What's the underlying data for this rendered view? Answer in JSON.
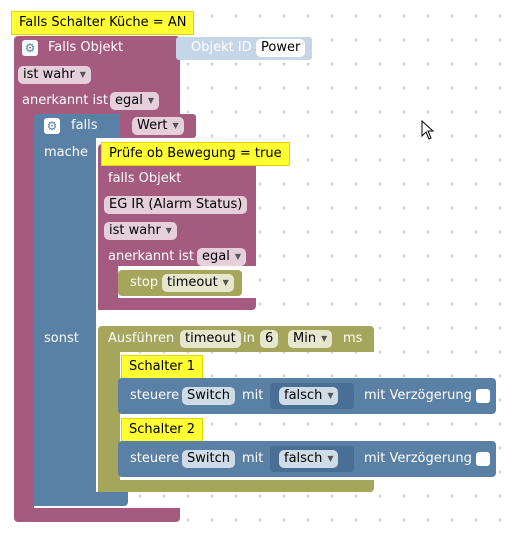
{
  "outer_block": {
    "comment": "Falls Schalter Küche = AN",
    "label": "Falls Objekt",
    "object_id_label": "Objekt ID",
    "object_id_value": "Power",
    "condition": "ist wahr",
    "ack_label": "anerkannt ist",
    "ack_value": "egal"
  },
  "if_block": {
    "if_label": "falls",
    "condition_value": "Wert",
    "then_label": "mache",
    "else_label": "sonst"
  },
  "inner_block": {
    "comment": "Prüfe ob Bewegung = true",
    "label": "falls Objekt",
    "object_value": "EG IR (Alarm Status)",
    "condition": "ist wahr",
    "ack_label": "anerkannt ist",
    "ack_value": "egal",
    "stop_label": "stop",
    "stop_value": "timeout"
  },
  "timeout_block": {
    "label": "Ausführen",
    "name_value": "timeout",
    "in_label": "in",
    "amount": "6",
    "unit": "Min",
    "ms_label": "ms"
  },
  "switch_blocks": [
    {
      "comment": "Schalter 1",
      "control_label": "steuere",
      "target": "Switch",
      "with_label": "mit",
      "value": "falsch",
      "delay_label": "mit Verzögerung"
    },
    {
      "comment": "Schalter 2",
      "control_label": "steuere",
      "target": "Switch",
      "with_label": "mit",
      "value": "falsch",
      "delay_label": "mit Verzögerung"
    }
  ],
  "colors": {
    "event": "#a55b80",
    "logic": "#5b80a5",
    "timer": "#a5a55b",
    "comment": "#ffff33"
  },
  "icons": {
    "gear": "gear-icon",
    "cursor": "mouse-cursor-icon",
    "dropdown": "chevron-down-icon"
  }
}
